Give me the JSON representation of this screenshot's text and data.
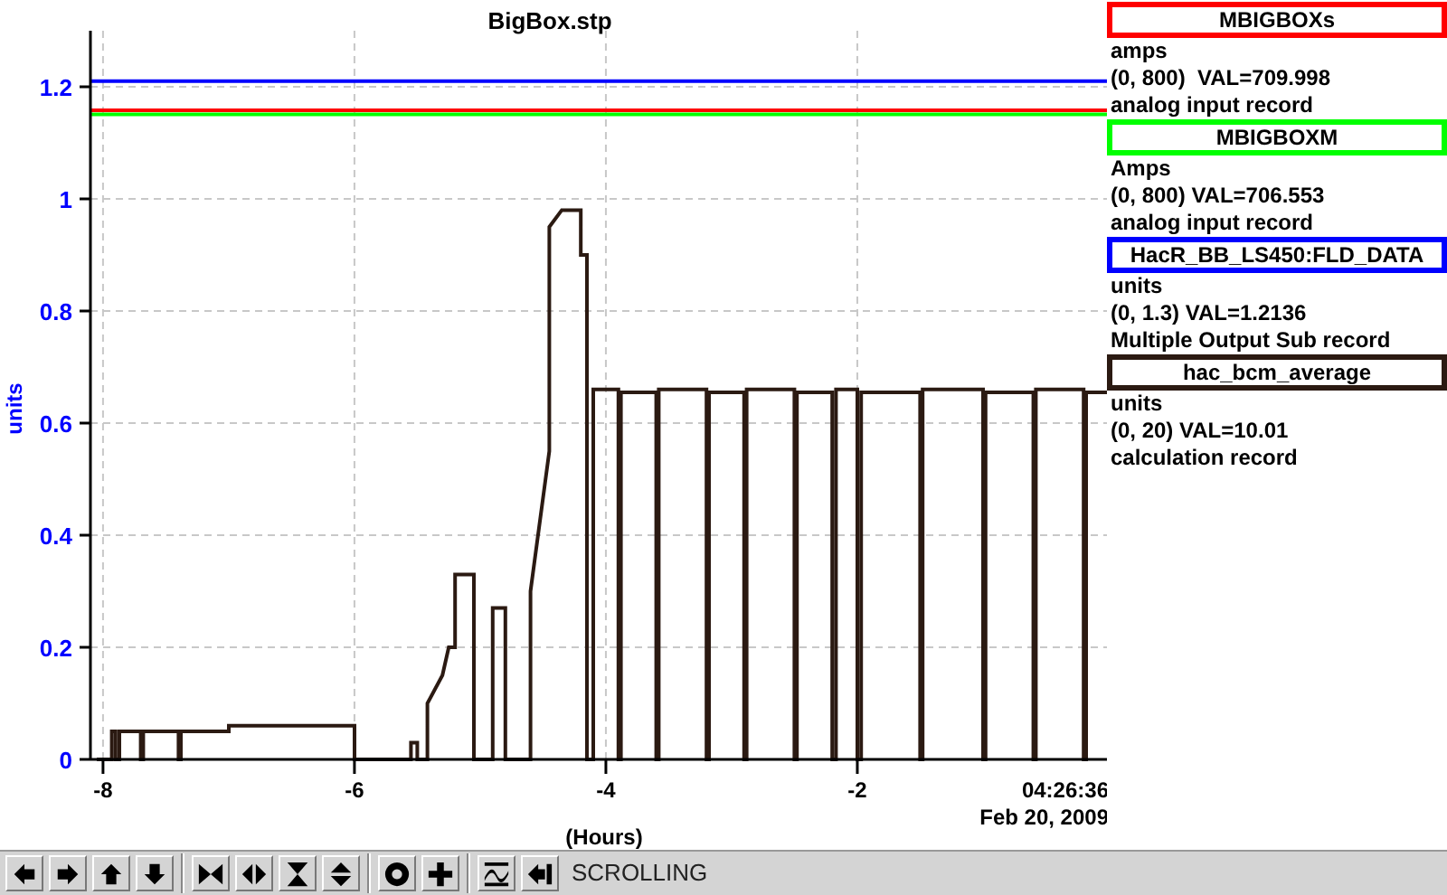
{
  "plot": {
    "chart_data": {
      "type": "line",
      "title": "BigBox.stp",
      "xlabel": "(Hours)",
      "ylabel": "units",
      "xlim": [
        -8.1,
        0
      ],
      "ylim": [
        0,
        1.3
      ],
      "grid": true,
      "xticks": [
        -8,
        -6,
        -4,
        -2
      ],
      "yticks": [
        {
          "value": 0,
          "label": "0"
        },
        {
          "value": 0.2,
          "label": "0.2"
        },
        {
          "value": 0.4,
          "label": "0.4"
        },
        {
          "value": 0.6,
          "label": "0.6"
        },
        {
          "value": 0.8,
          "label": "0.8"
        },
        {
          "value": 1,
          "label": "1"
        },
        {
          "value": 1.2,
          "label": "1.2"
        }
      ],
      "series": [
        {
          "name": "MBIGBOXs",
          "color": "#ff0000",
          "x": [
            -8.1,
            0
          ],
          "values": [
            1.158,
            1.158
          ]
        },
        {
          "name": "MBIGBOXM",
          "color": "#00ff00",
          "x": [
            -8.1,
            0
          ],
          "values": [
            1.151,
            1.151
          ]
        },
        {
          "name": "HacR_BB_LS450:FLD_DATA",
          "color": "#0000ff",
          "x": [
            -8.1,
            0
          ],
          "values": [
            1.21,
            1.21
          ]
        },
        {
          "name": "hac_bcm_average",
          "color": "#2b1a12",
          "x": [
            -8.05,
            -7.93,
            -7.93,
            -7.9,
            -7.9,
            -7.87,
            -7.87,
            -7.7,
            -7.7,
            -7.68,
            -7.68,
            -7.4,
            -7.4,
            -7.38,
            -7.38,
            -7.0,
            -7.0,
            -6.0,
            -6.0,
            -5.55,
            -5.55,
            -5.5,
            -5.5,
            -5.42,
            -5.42,
            -5.3,
            -5.25,
            -5.2,
            -5.2,
            -5.05,
            -5.05,
            -4.9,
            -4.9,
            -4.8,
            -4.8,
            -4.6,
            -4.6,
            -4.45,
            -4.45,
            -4.35,
            -4.2,
            -4.2,
            -4.15,
            -4.15,
            -4.1,
            -4.1,
            -3.9,
            -3.9,
            -3.88,
            -3.88,
            -3.6,
            -3.6,
            -3.58,
            -3.58,
            -3.2,
            -3.2,
            -3.18,
            -3.18,
            -2.9,
            -2.9,
            -2.88,
            -2.88,
            -2.5,
            -2.5,
            -2.48,
            -2.48,
            -2.2,
            -2.2,
            -2.17,
            -2.17,
            -2.0,
            -2.0,
            -1.97,
            -1.97,
            -1.5,
            -1.5,
            -1.48,
            -1.48,
            -1.0,
            -1.0,
            -0.98,
            -0.98,
            -0.6,
            -0.6,
            -0.58,
            -0.58,
            -0.2,
            -0.2,
            -0.18,
            -0.18,
            0
          ],
          "values": [
            0,
            0,
            0.05,
            0.05,
            0,
            0,
            0.05,
            0.05,
            0,
            0,
            0.05,
            0.05,
            0,
            0,
            0.05,
            0.05,
            0.06,
            0.06,
            0,
            0,
            0.03,
            0.03,
            0,
            0,
            0.1,
            0.15,
            0.2,
            0.2,
            0.33,
            0.33,
            0,
            0,
            0.27,
            0.27,
            0,
            0,
            0.3,
            0.55,
            0.95,
            0.98,
            0.98,
            0.9,
            0.9,
            0,
            0,
            0.66,
            0.66,
            0,
            0,
            0.655,
            0.655,
            0,
            0,
            0.66,
            0.66,
            0,
            0,
            0.655,
            0.655,
            0,
            0,
            0.66,
            0.66,
            0,
            0,
            0.655,
            0.655,
            0,
            0,
            0.66,
            0.66,
            0,
            0,
            0.655,
            0.655,
            0,
            0,
            0.66,
            0.66,
            0,
            0,
            0.655,
            0.655,
            0,
            0,
            0.66,
            0.66,
            0,
            0,
            0.655,
            0.655
          ]
        }
      ]
    },
    "end_time": "04:26:36",
    "date": "Feb 20, 2009"
  },
  "legend": [
    {
      "units": "amps",
      "reading": "(0, 800)  VAL=709.998",
      "record": "analog input record"
    },
    {
      "units": "Amps",
      "reading": "(0, 800) VAL=706.553",
      "record": "analog input record"
    },
    {
      "units": "units",
      "reading": "(0, 1.3) VAL=1.2136",
      "record": "Multiple Output Sub record"
    },
    {
      "units": "units",
      "reading": "(0, 20) VAL=10.01",
      "record": "calculation record"
    }
  ],
  "status": "SCROLLING"
}
